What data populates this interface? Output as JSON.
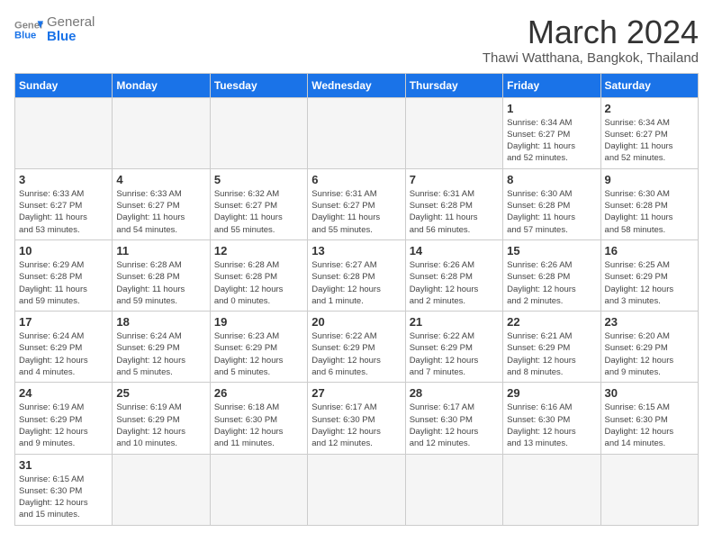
{
  "header": {
    "logo_general": "General",
    "logo_blue": "Blue",
    "month_title": "March 2024",
    "location": "Thawi Watthana, Bangkok, Thailand"
  },
  "days_of_week": [
    "Sunday",
    "Monday",
    "Tuesday",
    "Wednesday",
    "Thursday",
    "Friday",
    "Saturday"
  ],
  "weeks": [
    [
      {
        "day": "",
        "info": ""
      },
      {
        "day": "",
        "info": ""
      },
      {
        "day": "",
        "info": ""
      },
      {
        "day": "",
        "info": ""
      },
      {
        "day": "",
        "info": ""
      },
      {
        "day": "1",
        "info": "Sunrise: 6:34 AM\nSunset: 6:27 PM\nDaylight: 11 hours\nand 52 minutes."
      },
      {
        "day": "2",
        "info": "Sunrise: 6:34 AM\nSunset: 6:27 PM\nDaylight: 11 hours\nand 52 minutes."
      }
    ],
    [
      {
        "day": "3",
        "info": "Sunrise: 6:33 AM\nSunset: 6:27 PM\nDaylight: 11 hours\nand 53 minutes."
      },
      {
        "day": "4",
        "info": "Sunrise: 6:33 AM\nSunset: 6:27 PM\nDaylight: 11 hours\nand 54 minutes."
      },
      {
        "day": "5",
        "info": "Sunrise: 6:32 AM\nSunset: 6:27 PM\nDaylight: 11 hours\nand 55 minutes."
      },
      {
        "day": "6",
        "info": "Sunrise: 6:31 AM\nSunset: 6:27 PM\nDaylight: 11 hours\nand 55 minutes."
      },
      {
        "day": "7",
        "info": "Sunrise: 6:31 AM\nSunset: 6:28 PM\nDaylight: 11 hours\nand 56 minutes."
      },
      {
        "day": "8",
        "info": "Sunrise: 6:30 AM\nSunset: 6:28 PM\nDaylight: 11 hours\nand 57 minutes."
      },
      {
        "day": "9",
        "info": "Sunrise: 6:30 AM\nSunset: 6:28 PM\nDaylight: 11 hours\nand 58 minutes."
      }
    ],
    [
      {
        "day": "10",
        "info": "Sunrise: 6:29 AM\nSunset: 6:28 PM\nDaylight: 11 hours\nand 59 minutes."
      },
      {
        "day": "11",
        "info": "Sunrise: 6:28 AM\nSunset: 6:28 PM\nDaylight: 11 hours\nand 59 minutes."
      },
      {
        "day": "12",
        "info": "Sunrise: 6:28 AM\nSunset: 6:28 PM\nDaylight: 12 hours\nand 0 minutes."
      },
      {
        "day": "13",
        "info": "Sunrise: 6:27 AM\nSunset: 6:28 PM\nDaylight: 12 hours\nand 1 minute."
      },
      {
        "day": "14",
        "info": "Sunrise: 6:26 AM\nSunset: 6:28 PM\nDaylight: 12 hours\nand 2 minutes."
      },
      {
        "day": "15",
        "info": "Sunrise: 6:26 AM\nSunset: 6:28 PM\nDaylight: 12 hours\nand 2 minutes."
      },
      {
        "day": "16",
        "info": "Sunrise: 6:25 AM\nSunset: 6:29 PM\nDaylight: 12 hours\nand 3 minutes."
      }
    ],
    [
      {
        "day": "17",
        "info": "Sunrise: 6:24 AM\nSunset: 6:29 PM\nDaylight: 12 hours\nand 4 minutes."
      },
      {
        "day": "18",
        "info": "Sunrise: 6:24 AM\nSunset: 6:29 PM\nDaylight: 12 hours\nand 5 minutes."
      },
      {
        "day": "19",
        "info": "Sunrise: 6:23 AM\nSunset: 6:29 PM\nDaylight: 12 hours\nand 5 minutes."
      },
      {
        "day": "20",
        "info": "Sunrise: 6:22 AM\nSunset: 6:29 PM\nDaylight: 12 hours\nand 6 minutes."
      },
      {
        "day": "21",
        "info": "Sunrise: 6:22 AM\nSunset: 6:29 PM\nDaylight: 12 hours\nand 7 minutes."
      },
      {
        "day": "22",
        "info": "Sunrise: 6:21 AM\nSunset: 6:29 PM\nDaylight: 12 hours\nand 8 minutes."
      },
      {
        "day": "23",
        "info": "Sunrise: 6:20 AM\nSunset: 6:29 PM\nDaylight: 12 hours\nand 9 minutes."
      }
    ],
    [
      {
        "day": "24",
        "info": "Sunrise: 6:19 AM\nSunset: 6:29 PM\nDaylight: 12 hours\nand 9 minutes."
      },
      {
        "day": "25",
        "info": "Sunrise: 6:19 AM\nSunset: 6:29 PM\nDaylight: 12 hours\nand 10 minutes."
      },
      {
        "day": "26",
        "info": "Sunrise: 6:18 AM\nSunset: 6:30 PM\nDaylight: 12 hours\nand 11 minutes."
      },
      {
        "day": "27",
        "info": "Sunrise: 6:17 AM\nSunset: 6:30 PM\nDaylight: 12 hours\nand 12 minutes."
      },
      {
        "day": "28",
        "info": "Sunrise: 6:17 AM\nSunset: 6:30 PM\nDaylight: 12 hours\nand 12 minutes."
      },
      {
        "day": "29",
        "info": "Sunrise: 6:16 AM\nSunset: 6:30 PM\nDaylight: 12 hours\nand 13 minutes."
      },
      {
        "day": "30",
        "info": "Sunrise: 6:15 AM\nSunset: 6:30 PM\nDaylight: 12 hours\nand 14 minutes."
      }
    ],
    [
      {
        "day": "31",
        "info": "Sunrise: 6:15 AM\nSunset: 6:30 PM\nDaylight: 12 hours\nand 15 minutes."
      },
      {
        "day": "",
        "info": ""
      },
      {
        "day": "",
        "info": ""
      },
      {
        "day": "",
        "info": ""
      },
      {
        "day": "",
        "info": ""
      },
      {
        "day": "",
        "info": ""
      },
      {
        "day": "",
        "info": ""
      }
    ]
  ]
}
